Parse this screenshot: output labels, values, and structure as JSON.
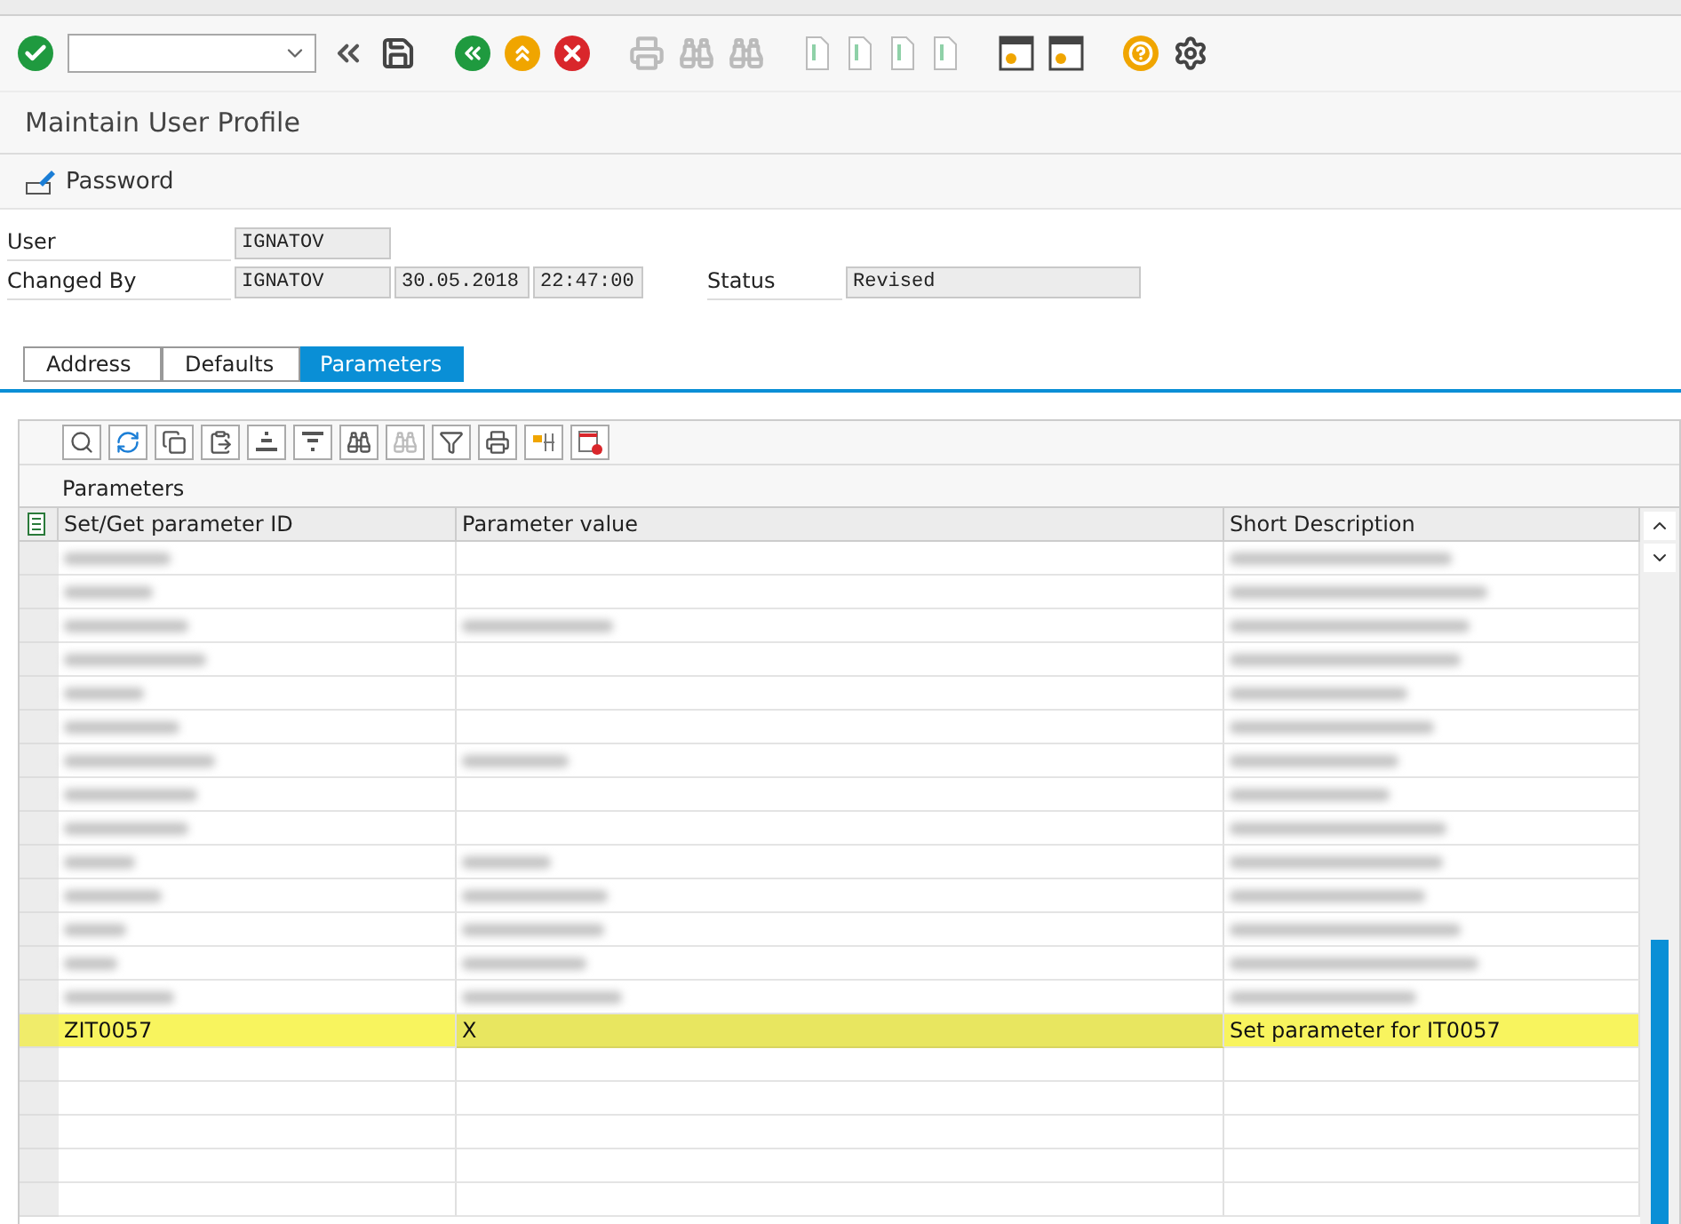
{
  "title": "Maintain User Profile",
  "actions": [
    {
      "label": "Password"
    }
  ],
  "header_fields": [
    {
      "label": "User",
      "values": [
        "IGNATOV"
      ]
    },
    {
      "label": "Changed By",
      "values": [
        "IGNATOV",
        "30.05.2018",
        "22:47:00"
      ],
      "extra_label": "Status",
      "extra_value": "Revised"
    }
  ],
  "tabs": [
    {
      "label": "Address",
      "selected": false
    },
    {
      "label": "Defaults",
      "selected": false
    },
    {
      "label": "Parameters",
      "selected": true
    }
  ],
  "grid": {
    "title": "Parameters",
    "columns": [
      "Set/Get parameter ID",
      "Parameter value",
      "Short Description"
    ],
    "rows": [
      {
        "kind": "blurred",
        "has_value": false
      },
      {
        "kind": "blurred",
        "has_value": false
      },
      {
        "kind": "blurred",
        "has_value": true
      },
      {
        "kind": "blurred",
        "has_value": false
      },
      {
        "kind": "blurred",
        "has_value": false
      },
      {
        "kind": "blurred",
        "has_value": false
      },
      {
        "kind": "blurred",
        "has_value": true
      },
      {
        "kind": "blurred",
        "has_value": false
      },
      {
        "kind": "blurred",
        "has_value": false
      },
      {
        "kind": "blurred",
        "has_value": true
      },
      {
        "kind": "blurred",
        "has_value": true
      },
      {
        "kind": "blurred",
        "has_value": true
      },
      {
        "kind": "blurred",
        "has_value": true
      },
      {
        "kind": "blurred",
        "has_value": true
      },
      {
        "kind": "text",
        "cells": [
          "ZIT0057",
          "X",
          "Set parameter for IT0057"
        ],
        "selected": true
      },
      {
        "kind": "empty"
      },
      {
        "kind": "empty"
      },
      {
        "kind": "empty"
      },
      {
        "kind": "empty"
      },
      {
        "kind": "empty"
      }
    ]
  }
}
